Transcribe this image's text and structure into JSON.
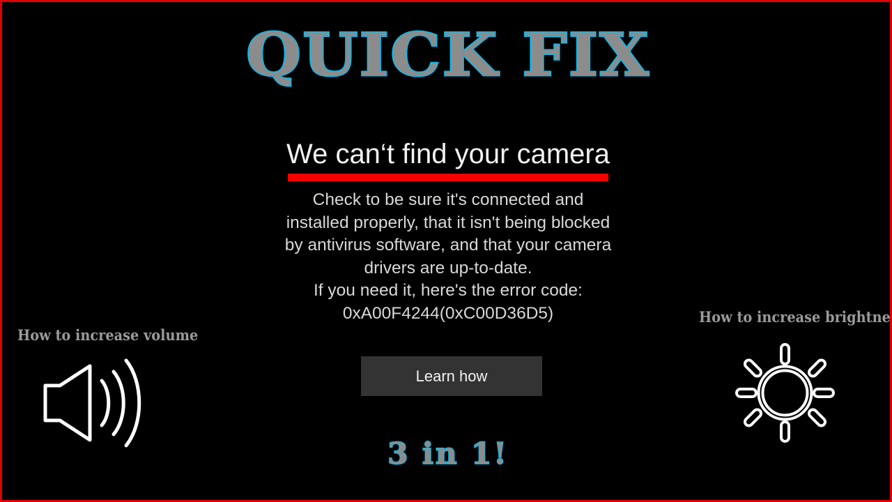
{
  "frame": {
    "border_color": "#e00000",
    "background_color": "#000000"
  },
  "title": {
    "text": "QUICK FIX",
    "fill_color": "#8c8c8c",
    "outline_color": "#00bdf0"
  },
  "error_panel": {
    "heading": "We can‘t find your camera",
    "underline_color": "#f50000",
    "body_lines": [
      "Check to be sure it's connected and",
      "installed properly, that it isn't being blocked",
      "by antivirus software, and that your camera",
      "drivers are up-to-date.",
      "If you need it, here's the error code:",
      "0xA00F4244(0xC00D36D5)"
    ],
    "error_code": "0xA00F4244(0xC00D36D5)",
    "button_label": "Learn how",
    "button_color": "#333333"
  },
  "callouts": {
    "volume": {
      "label": "How to increase volume",
      "icon": "speaker-volume-icon",
      "color": "#9a9a9a"
    },
    "brightness": {
      "label": "How to increase brightness",
      "icon": "sun-brightness-icon",
      "color": "#9a9a9a"
    }
  },
  "tagline": {
    "text": "3 in 1!",
    "fill_color": "#8c8c8c",
    "outline_color": "#00bdf0"
  }
}
